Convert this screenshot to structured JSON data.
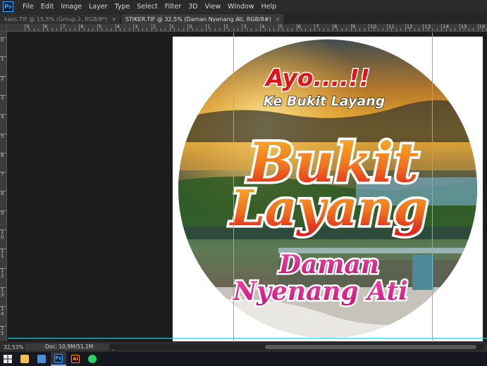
{
  "app": {
    "logo_text": "Ps"
  },
  "menu": [
    "File",
    "Edit",
    "Image",
    "Layer",
    "Type",
    "Select",
    "Filter",
    "3D",
    "View",
    "Window",
    "Help"
  ],
  "tabs": [
    {
      "label": "kaos.TIF @ 15,5% (Group 2, RGB/8*)",
      "close": "×",
      "active": false
    },
    {
      "label": "STIKER.TIF @ 32,5% (Daman Nyenang Ati, RGB/8#)",
      "close": "×",
      "active": true
    }
  ],
  "ruler_top_labels": [
    "9",
    "8",
    "7",
    "6",
    "5",
    "4",
    "3",
    "2",
    "1",
    "0",
    "1",
    "2",
    "3",
    "4",
    "5",
    "6",
    "7",
    "8",
    "9",
    "10",
    "11",
    "12",
    "13",
    "14",
    "15",
    "16",
    "17"
  ],
  "ruler_left_labels": [
    "0",
    "1",
    "2",
    "3",
    "4",
    "5",
    "6",
    "7",
    "8",
    "9",
    "1 0",
    "1 1",
    "1 2",
    "1 3",
    "1 4",
    "1 5"
  ],
  "sticker": {
    "line1": "Ayo....!!",
    "line2": "Ke Bukit Layang",
    "title1": "Bukit",
    "title2": "Layang",
    "sub1": "Daman",
    "sub2": "Nyenang Ati",
    "colors": {
      "red": "#e0141b",
      "orange": "#f7a21b",
      "magenta": "#e0168a",
      "white": "#ffffff"
    }
  },
  "status": {
    "zoom": "32,53%",
    "doc": "Doc: 10,9M/51,1M",
    "arrow": "❯"
  },
  "taskbar": [
    {
      "name": "start-icon",
      "label": ""
    },
    {
      "name": "file-explorer-icon",
      "label": ""
    },
    {
      "name": "store-icon",
      "label": ""
    },
    {
      "name": "photoshop-icon",
      "label": "Ps"
    },
    {
      "name": "illustrator-icon",
      "label": "Ai"
    },
    {
      "name": "whatsapp-icon",
      "label": ""
    }
  ]
}
